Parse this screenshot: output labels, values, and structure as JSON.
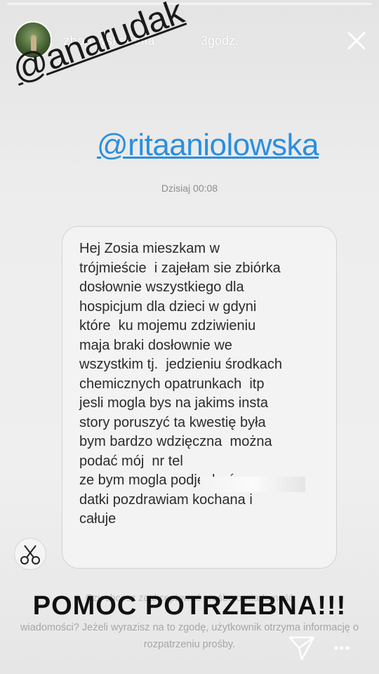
{
  "story": {
    "username": "zborowskazofia",
    "time_ago": "3godz.",
    "mentions": [
      "@anarudak",
      "@ritaaniolowska"
    ],
    "date_label": "Dzisiaj 00:08",
    "message": "Hej Zosia mieszkam w\ntrójmieście  i zajełam sie zbiórka\ndosłownie wszystkiego dla\nhospicjum dla dzieci w gdyni\nktóre  ku mojemu zdziwieniu\nmaja braki dosłownie we\nwszystkim tj.  jedzieniu środkach\nchemicznych opatrunkach  itp\njesli mogla bys na jakims insta\nstory poruszyć ta kwestię była\nbym bardzo wdzięczna  można\npodać mój  nr tel\nze bym mogla podjechać po\ndatki pozdrawiam kochana i\ncałuje",
    "headline": "POMOC POTRZEBNA!!!",
    "faded_line": "Czy chcesz zaakceptować prośbę o wiadomość",
    "info_text": "wiadomości? Jeżeli wyrazisz na to zgodę, użytkownik otrzyma informację o rozpatrzeniu prośby."
  },
  "icons": {
    "close": "close-icon",
    "sender": "scissors-icon",
    "send": "paper-plane-icon",
    "more": "more-dots-icon"
  },
  "colors": {
    "mention_primary": "#1a1a1a",
    "mention_link": "#2a8fe0",
    "headline": "#111111"
  }
}
